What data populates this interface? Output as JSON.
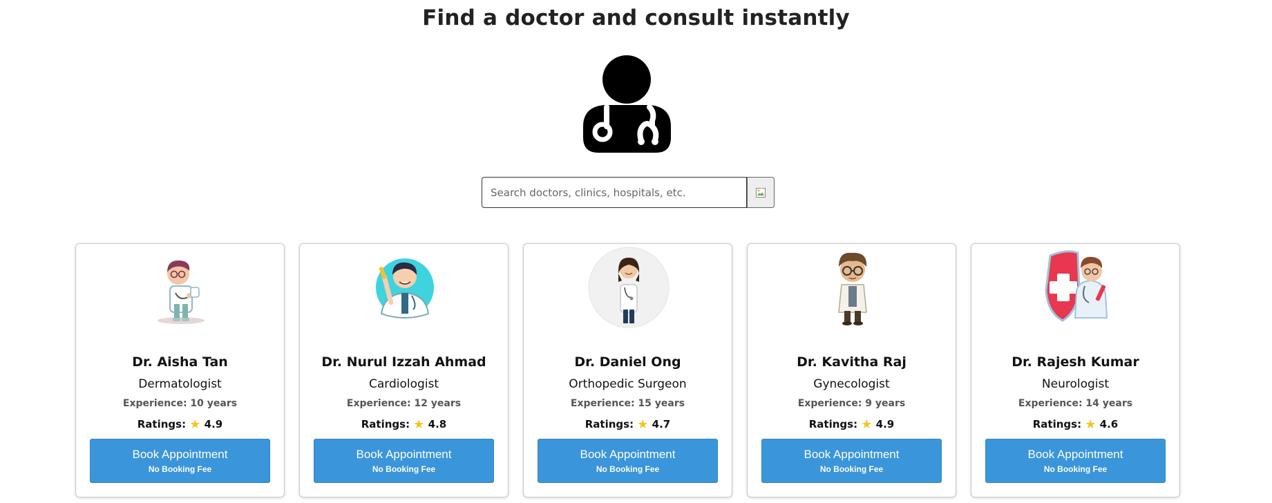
{
  "header": {
    "title": "Find a doctor and consult instantly"
  },
  "hero": {
    "icon": "doctor-stethoscope-icon"
  },
  "search": {
    "placeholder": "Search doctors, clinics, hospitals, etc.",
    "value": "",
    "button_icon": "broken-image-icon"
  },
  "doctors": [
    {
      "name": "Dr. Aisha Tan",
      "specialty": "Dermatologist",
      "experience": "Experience: 10 years",
      "ratings_label": "Ratings:",
      "rating": "4.9",
      "button_label": "Book Appointment",
      "button_sub": "No Booking Fee"
    },
    {
      "name": "Dr. Nurul Izzah Ahmad",
      "specialty": "Cardiologist",
      "experience": "Experience: 12 years",
      "ratings_label": "Ratings:",
      "rating": "4.8",
      "button_label": "Book Appointment",
      "button_sub": "No Booking Fee"
    },
    {
      "name": "Dr. Daniel Ong",
      "specialty": "Orthopedic Surgeon",
      "experience": "Experience: 15 years",
      "ratings_label": "Ratings:",
      "rating": "4.7",
      "button_label": "Book Appointment",
      "button_sub": "No Booking Fee"
    },
    {
      "name": "Dr. Kavitha Raj",
      "specialty": "Gynecologist",
      "experience": "Experience: 9 years",
      "ratings_label": "Ratings:",
      "rating": "4.9",
      "button_label": "Book Appointment",
      "button_sub": "No Booking Fee"
    },
    {
      "name": "Dr. Rajesh Kumar",
      "specialty": "Neurologist",
      "experience": "Experience: 14 years",
      "ratings_label": "Ratings:",
      "rating": "4.6",
      "button_label": "Book Appointment",
      "button_sub": "No Booking Fee"
    }
  ],
  "colors": {
    "button": "#3a95db",
    "star": "#f5c518"
  }
}
